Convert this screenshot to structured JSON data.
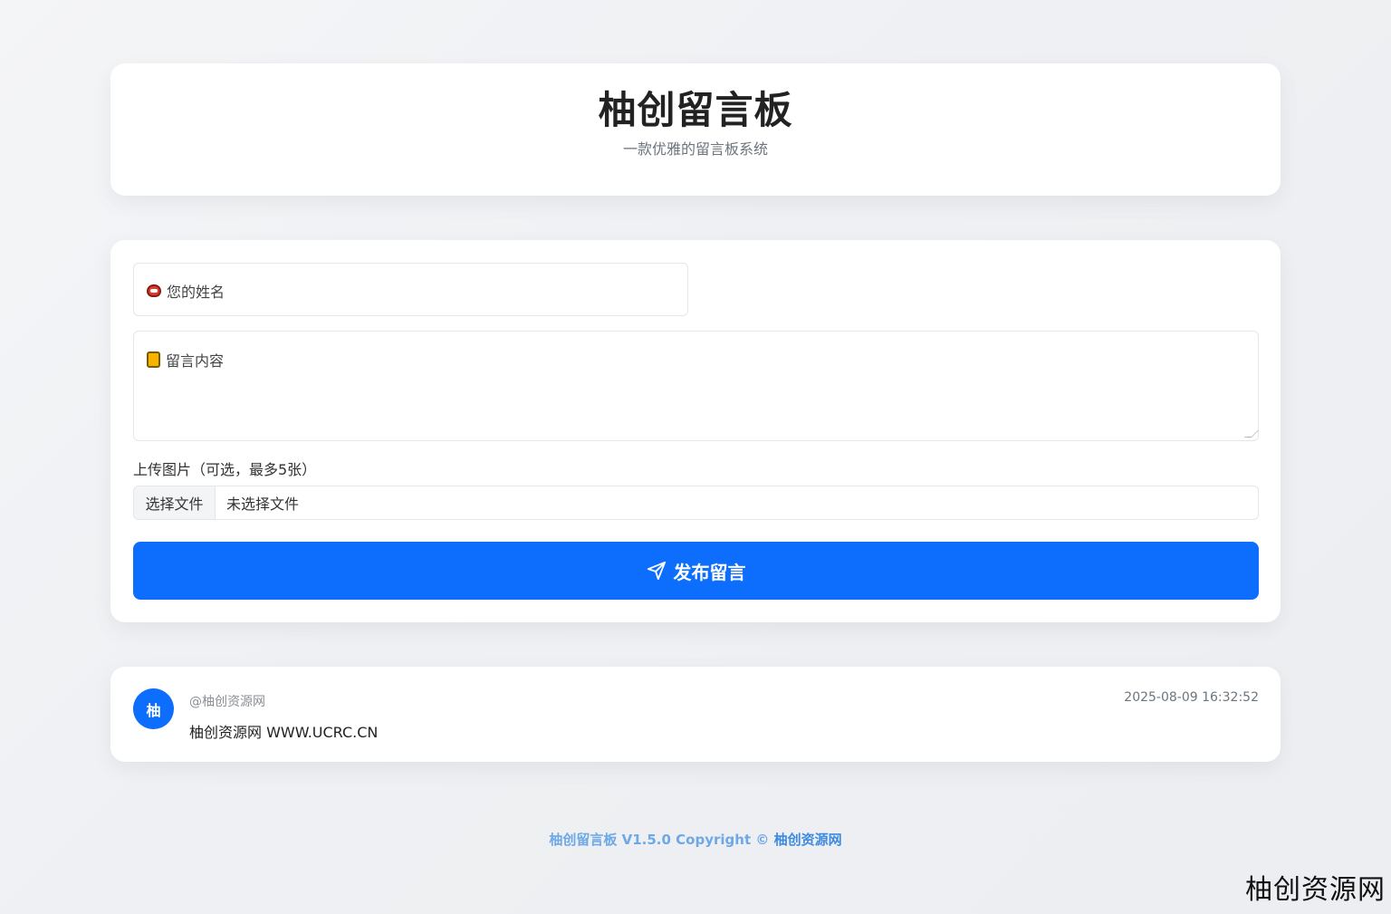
{
  "header": {
    "title": "柚创留言板",
    "subtitle": "一款优雅的留言板系统"
  },
  "form": {
    "name_placeholder": "您的姓名",
    "name_icon": "face-emoji-icon",
    "message_placeholder": "留言内容",
    "message_icon": "memo-icon",
    "upload_label": "上传图片（可选，最多5张）",
    "file_button": "选择文件",
    "file_status": "未选择文件",
    "submit_label": "发布留言",
    "accent_color": "#0d6efd"
  },
  "messages": [
    {
      "avatar_char": "柚",
      "author": "@柚创资源网",
      "text": "柚创资源网 WWW.UCRC.CN",
      "time": "2025-08-09 16:32:52"
    }
  ],
  "footer": {
    "text": "柚创留言板 V1.5.0 Copyright © ",
    "link": "柚创资源网"
  },
  "watermark": "柚创资源网"
}
